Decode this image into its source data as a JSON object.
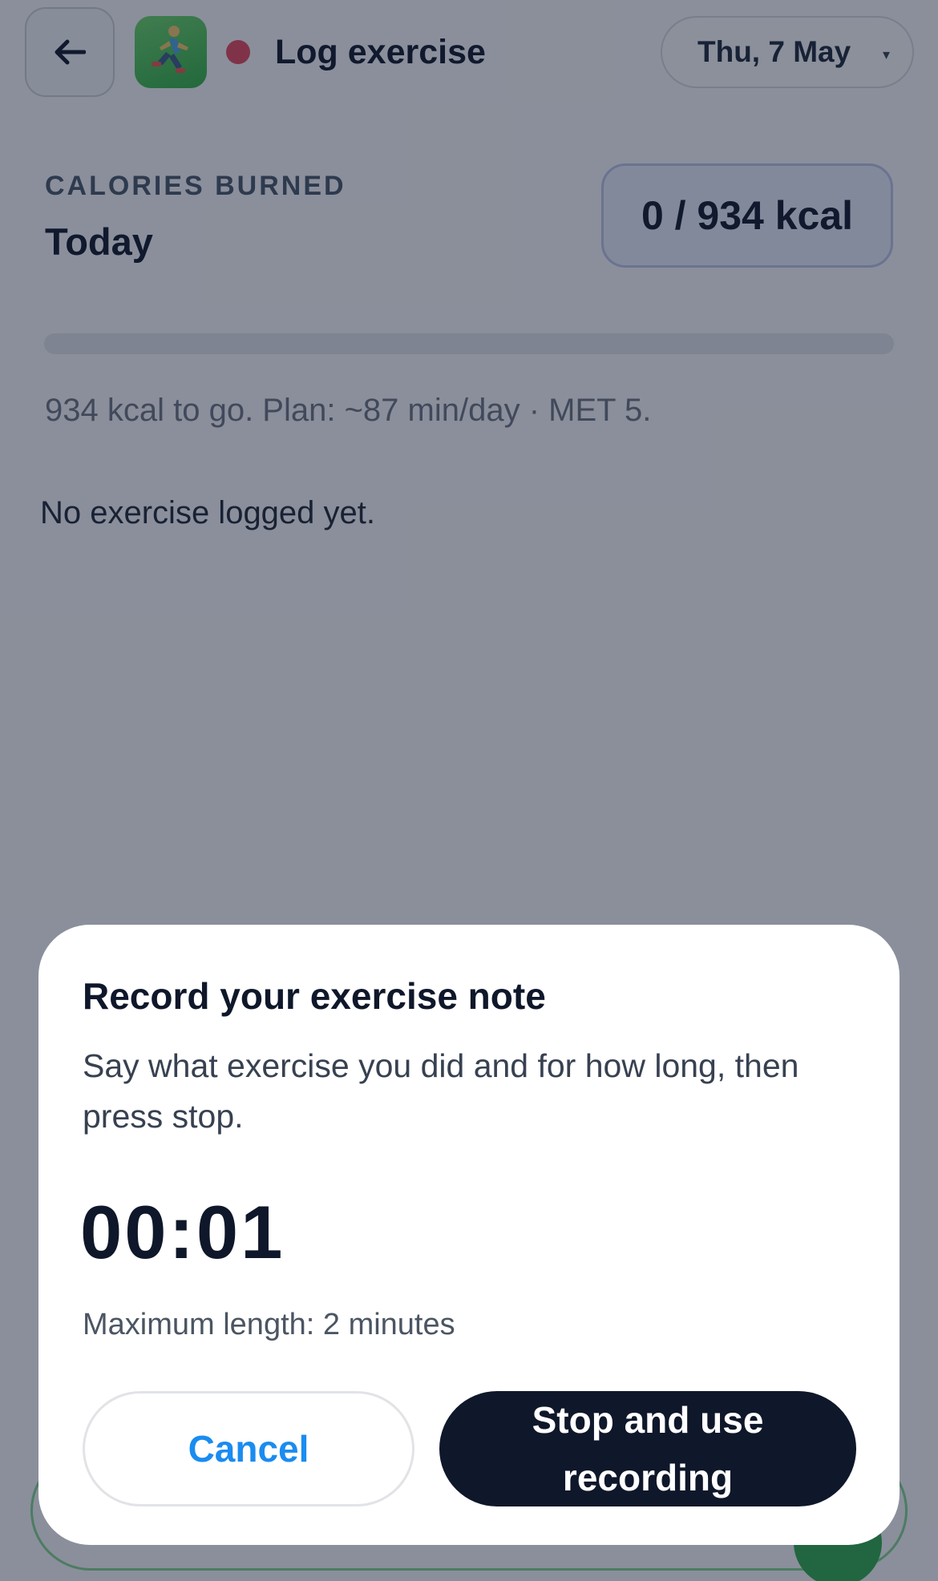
{
  "header": {
    "title": "Log exercise",
    "date_label": "Thu, 7 May",
    "date_caret": "▾"
  },
  "calories": {
    "label": "CALORIES BURNED",
    "period": "Today",
    "value": "0 / 934 kcal",
    "progress_fraction": 0,
    "plan_text": "934 kcal to go. Plan: ~87 min/day · MET 5."
  },
  "exercise_list": {
    "empty_text": "No exercise logged yet."
  },
  "modal": {
    "title": "Record your exercise note",
    "description": "Say what exercise you did and for how long, then press stop.",
    "timer": "00:01",
    "max_length": "Maximum length: 2 minutes",
    "cancel_label": "Cancel",
    "stop_label": "Stop and use recording"
  },
  "colors": {
    "accent_blue": "#1a8cf0",
    "record_dot": "#e0495e",
    "dark_button": "#0f172a",
    "app_icon_green": "#2fae45"
  },
  "icons": {
    "back": "arrow-left-icon",
    "app": "running-person-icon",
    "recording": "record-dot-icon",
    "dropdown": "caret-down-icon"
  }
}
